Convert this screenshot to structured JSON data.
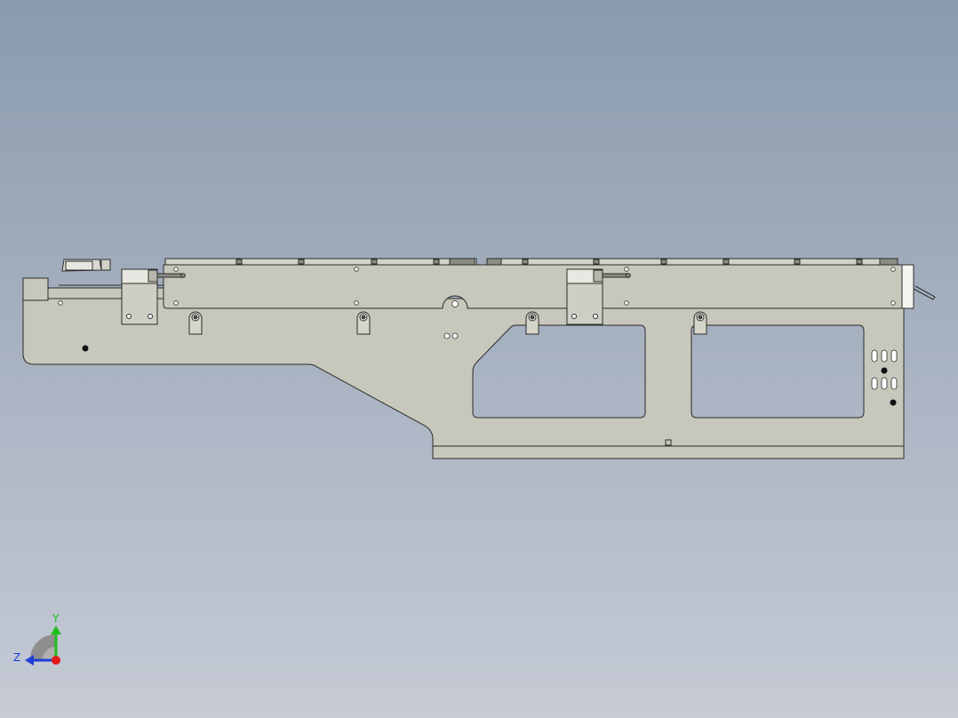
{
  "viewport": {
    "background_top": "#8a9aae",
    "background_bottom": "#c6cbd5"
  },
  "model": {
    "part_fill": "#c8c7bb",
    "edge_color": "#2b2b2b",
    "window_fill": "#a9b2c0"
  },
  "triad": {
    "y_label": "Y",
    "z_label": "Z",
    "y_color": "#1fbf1f",
    "z_color": "#1f3fd6",
    "x_color": "#e21b1b"
  }
}
